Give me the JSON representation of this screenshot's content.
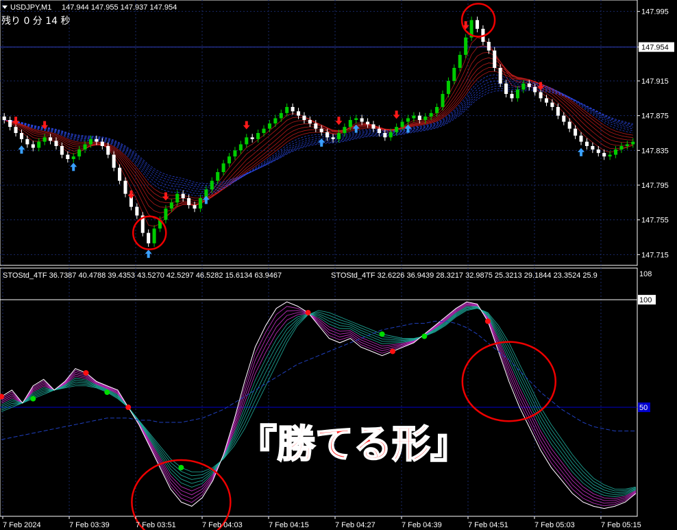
{
  "header": {
    "symbol_label": "USDJPY,M1",
    "ohlc_label": "147.944 147.955 147.937 147.954",
    "countdown": "残り 0 分 14 秒"
  },
  "indicator_header": {
    "line1": "STOStd_4TF 36.7387 40.4788 39.4353 43.5270 42.5297 46.5282 15.6134 63.9467",
    "line2": "STOStd_4TF 32.6226 36.9439 28.3217 32.9875 25.3213 29.1844 23.3524 25.9"
  },
  "overlay_caption": "『勝てる形』",
  "colors": {
    "background": "#000000",
    "grid": "#1a2a6a",
    "bull_candle": "#00cc00",
    "bear_candle": "#ffffff",
    "up_arrow": "#3aa0ff",
    "down_arrow": "#ff1a1a",
    "ribbon_red": "#e02020",
    "ribbon_blue": "#3050ff",
    "osc_magenta": "#cc33cc",
    "osc_teal": "#20b0a0",
    "circle": "#ee0000",
    "level_50": "#0000cc"
  },
  "chart_data": [
    {
      "type": "candlestick",
      "title": "USDJPY,M1",
      "ylim": [
        147.705,
        148.005
      ],
      "y_ticks": [
        "147.995",
        "147.954",
        "147.915",
        "147.875",
        "147.835",
        "147.795",
        "147.755",
        "147.715"
      ],
      "current_price": "147.954",
      "x_ticks": [
        "7 Feb 2024",
        "7 Feb 03:39",
        "7 Feb 03:51",
        "7 Feb 04:03",
        "7 Feb 04:15",
        "7 Feb 04:27",
        "7 Feb 04:39",
        "7 Feb 04:51",
        "7 Feb 05:03",
        "7 Feb 05:15"
      ],
      "close": [
        147.87,
        147.862,
        147.855,
        147.848,
        147.842,
        147.838,
        147.845,
        147.85,
        147.846,
        147.84,
        147.83,
        147.825,
        147.828,
        147.836,
        147.842,
        147.848,
        147.845,
        147.84,
        147.83,
        147.815,
        147.8,
        147.785,
        147.77,
        147.76,
        147.74,
        147.728,
        147.745,
        147.755,
        147.768,
        147.775,
        147.785,
        147.78,
        147.772,
        147.768,
        147.78,
        147.79,
        147.8,
        147.81,
        147.82,
        147.828,
        147.835,
        147.842,
        147.85,
        147.848,
        147.855,
        147.86,
        147.866,
        147.872,
        147.878,
        147.885,
        147.88,
        147.875,
        147.87,
        147.866,
        147.86,
        147.856,
        147.85,
        147.848,
        147.855,
        147.862,
        147.87,
        147.872,
        147.868,
        147.865,
        147.86,
        147.855,
        147.85,
        147.856,
        147.862,
        147.868,
        147.872,
        147.875,
        147.87,
        147.874,
        147.878,
        147.885,
        147.9,
        147.915,
        147.93,
        147.945,
        147.965,
        147.985,
        147.975,
        147.96,
        147.95,
        147.93,
        147.912,
        147.9,
        147.895,
        147.905,
        147.912,
        147.908,
        147.902,
        147.895,
        147.89,
        147.885,
        147.875,
        147.868,
        147.86,
        147.852,
        147.845,
        147.84,
        147.836,
        147.832,
        147.828,
        147.83,
        147.836,
        147.84,
        147.842,
        147.845
      ],
      "up_arrow_idx": [
        3,
        12,
        25,
        35,
        55,
        61,
        70,
        100
      ],
      "down_arrow_idx": [
        2,
        7,
        22,
        28,
        42,
        58,
        68,
        80,
        93
      ],
      "circles_idx": [
        24,
        81
      ]
    },
    {
      "type": "line",
      "title": "STOStd_4TF",
      "ylim": [
        0,
        108
      ],
      "y_ticks": [
        "108",
        "100",
        "50"
      ],
      "level_line": 50,
      "series_fast": [
        55,
        58,
        52,
        60,
        63,
        58,
        62,
        68,
        66,
        62,
        60,
        58,
        50,
        42,
        32,
        22,
        12,
        6,
        4,
        8,
        16,
        28,
        44,
        62,
        78,
        88,
        96,
        99,
        97,
        94,
        88,
        82,
        80,
        82,
        78,
        76,
        74,
        76,
        78,
        80,
        84,
        88,
        92,
        96,
        99,
        98,
        90,
        76,
        62,
        50,
        40,
        30,
        22,
        16,
        10,
        6,
        4,
        3,
        4,
        6,
        10
      ],
      "series_slow": [
        48,
        50,
        52,
        54,
        56,
        58,
        59,
        60,
        60,
        59,
        57,
        54,
        50,
        44,
        38,
        32,
        26,
        22,
        20,
        20,
        22,
        26,
        32,
        40,
        50,
        60,
        70,
        80,
        88,
        93,
        95,
        94,
        92,
        90,
        88,
        86,
        84,
        83,
        82,
        82,
        83,
        85,
        88,
        92,
        95,
        96,
        94,
        88,
        80,
        70,
        60,
        50,
        42,
        35,
        28,
        22,
        17,
        14,
        12,
        12,
        13
      ],
      "series_trend": [
        35,
        36,
        37,
        38,
        39,
        40,
        41,
        42,
        43,
        44,
        45,
        45,
        45,
        44,
        44,
        43,
        43,
        43,
        44,
        45,
        47,
        49,
        52,
        55,
        58,
        61,
        64,
        67,
        70,
        72,
        74,
        76,
        78,
        80,
        82,
        84,
        86,
        87,
        88,
        89,
        89,
        90,
        90,
        89,
        87,
        84,
        80,
        76,
        72,
        67,
        62,
        57,
        53,
        49,
        46,
        43,
        41,
        40,
        39,
        39,
        39
      ],
      "green_dots_idx": [
        3,
        10,
        17,
        36,
        40
      ],
      "red_dots_idx": [
        0,
        8,
        12,
        29,
        37,
        46
      ]
    }
  ]
}
